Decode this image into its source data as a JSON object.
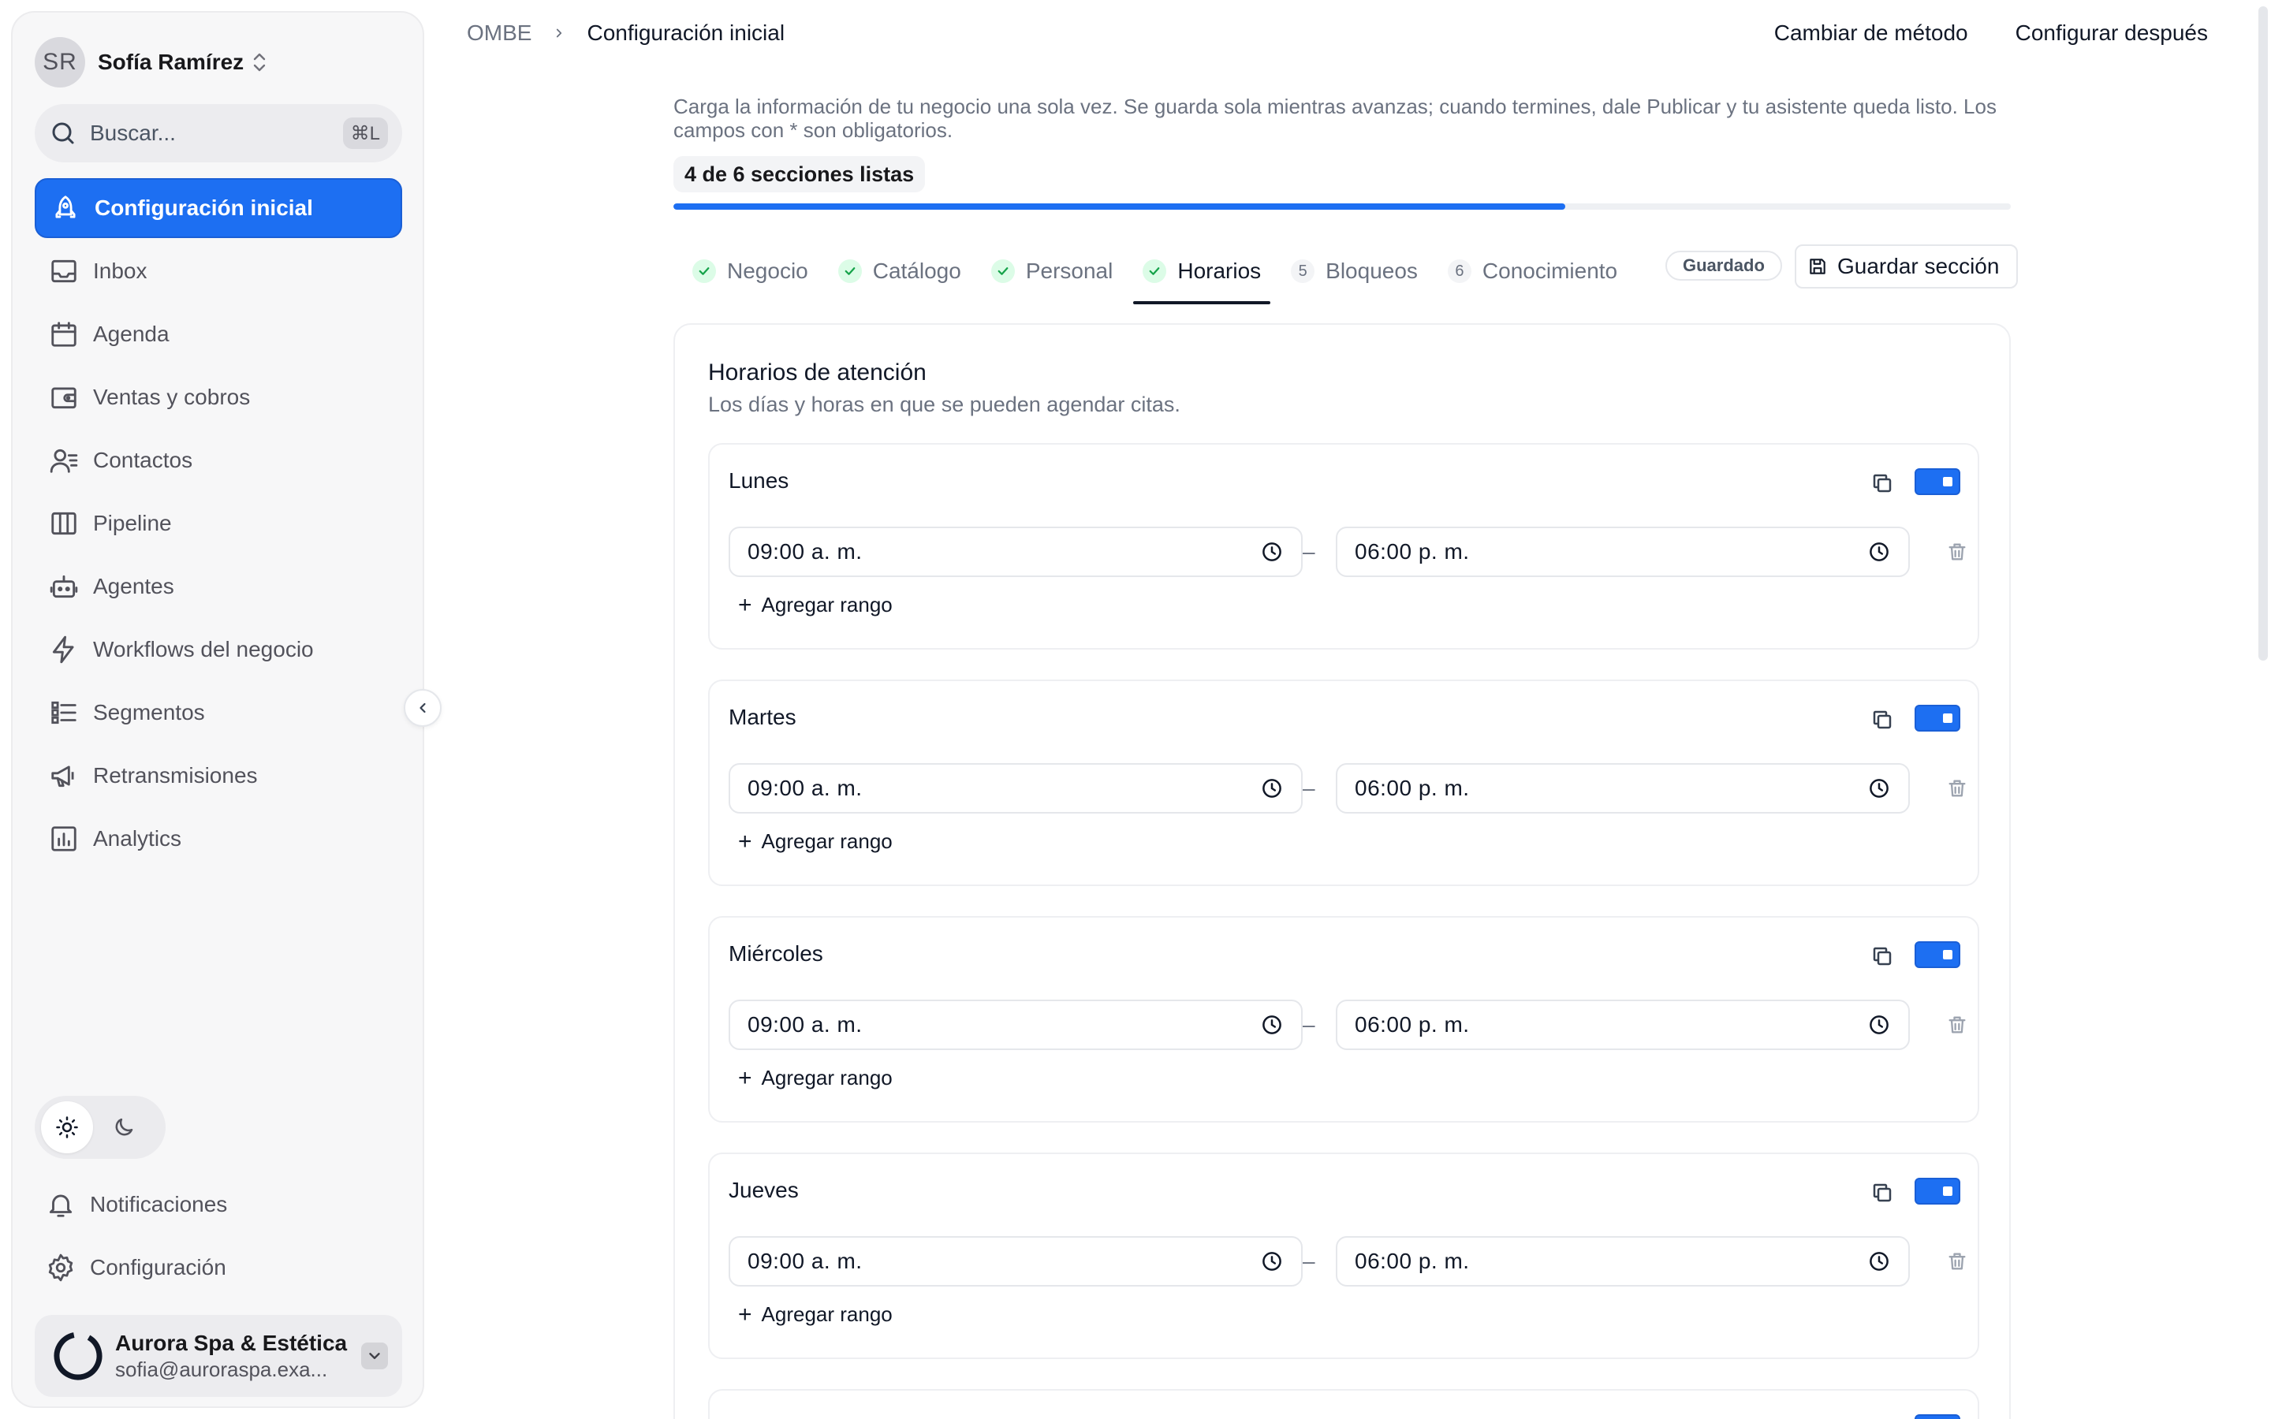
{
  "sidebar": {
    "user": {
      "initials": "SR",
      "name": "Sofía Ramírez"
    },
    "search": {
      "placeholder": "Buscar...",
      "shortcut": "⌘L"
    },
    "items": [
      {
        "label": "Configuración inicial",
        "icon": "rocket-icon",
        "active": true
      },
      {
        "label": "Inbox",
        "icon": "inbox-icon"
      },
      {
        "label": "Agenda",
        "icon": "calendar-icon"
      },
      {
        "label": "Ventas y cobros",
        "icon": "wallet-icon"
      },
      {
        "label": "Contactos",
        "icon": "contacts-icon"
      },
      {
        "label": "Pipeline",
        "icon": "columns-icon"
      },
      {
        "label": "Agentes",
        "icon": "bot-icon"
      },
      {
        "label": "Workflows del negocio",
        "icon": "bolt-icon"
      },
      {
        "label": "Segmentos",
        "icon": "list-icon"
      },
      {
        "label": "Retransmisiones",
        "icon": "megaphone-icon"
      },
      {
        "label": "Analytics",
        "icon": "chart-icon"
      }
    ],
    "theme": {
      "selected": "light"
    },
    "bottom": [
      {
        "label": "Notificaciones",
        "icon": "bell-icon"
      },
      {
        "label": "Configuración",
        "icon": "gear-icon"
      }
    ],
    "account": {
      "name": "Aurora Spa & Estética",
      "email": "sofia@auroraspa.exa..."
    }
  },
  "header": {
    "breadcrumb": {
      "root": "OMBE",
      "current": "Configuración inicial"
    },
    "actions": {
      "change_method": "Cambiar de método",
      "configure_later": "Configurar después"
    }
  },
  "main": {
    "intro": "Carga la información de tu negocio una sola vez. Se guarda sola mientras avanzas; cuando termines, dale Publicar y tu asistente queda listo. Los campos con * son obligatorios.",
    "progress": {
      "label": "4 de 6 secciones listas",
      "fraction": 0.6667
    },
    "tabs": [
      {
        "label": "Negocio",
        "status": "done"
      },
      {
        "label": "Catálogo",
        "status": "done"
      },
      {
        "label": "Personal",
        "status": "done"
      },
      {
        "label": "Horarios",
        "status": "done",
        "active": true
      },
      {
        "label": "Bloqueos",
        "number": "5"
      },
      {
        "label": "Conocimiento",
        "number": "6"
      }
    ],
    "saved_badge": "Guardado",
    "save_button": "Guardar sección",
    "hours": {
      "title": "Horarios de atención",
      "subtitle": "Los días y horas en que se pueden agendar citas.",
      "add_range_label": "Agregar rango",
      "days": [
        {
          "name": "Lunes",
          "enabled": true,
          "start": "09:00  a. m.",
          "end": "06:00  p. m."
        },
        {
          "name": "Martes",
          "enabled": true,
          "start": "09:00  a. m.",
          "end": "06:00  p. m."
        },
        {
          "name": "Miércoles",
          "enabled": true,
          "start": "09:00  a. m.",
          "end": "06:00  p. m."
        },
        {
          "name": "Jueves",
          "enabled": true,
          "start": "09:00  a. m.",
          "end": "06:00  p. m."
        }
      ]
    }
  },
  "colors": {
    "accent": "#1d6ff2",
    "check_green": "#16a34a"
  }
}
